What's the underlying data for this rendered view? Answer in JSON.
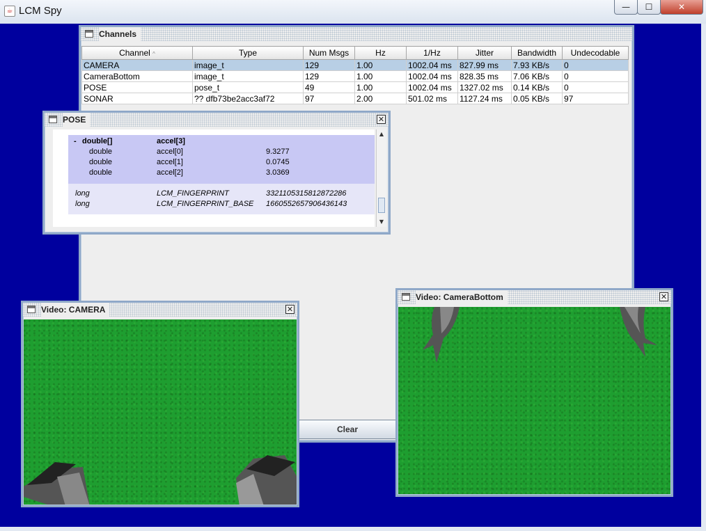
{
  "window": {
    "title": "LCM Spy",
    "controls": {
      "minimize": "—",
      "maximize": "☐",
      "close": "✕"
    }
  },
  "channels_frame": {
    "title": "Channels",
    "columns": [
      "Channel",
      "Type",
      "Num Msgs",
      "Hz",
      "1/Hz",
      "Jitter",
      "Bandwidth",
      "Undecodable"
    ],
    "sort_indicator": "^",
    "rows": [
      [
        "CAMERA",
        "image_t",
        "129",
        "1.00",
        "1002.04 ms",
        "827.99 ms",
        "7.93 KB/s",
        "0"
      ],
      [
        "CameraBottom",
        "image_t",
        "129",
        "1.00",
        "1002.04 ms",
        "828.35 ms",
        "7.06 KB/s",
        "0"
      ],
      [
        "POSE",
        "pose_t",
        "49",
        "1.00",
        "1002.04 ms",
        "1327.02 ms",
        "0.14 KB/s",
        "0"
      ],
      [
        "SONAR",
        "?? dfb73be2acc3af72",
        "97",
        "2.00",
        "501.02 ms",
        "1127.24 ms",
        "0.05 KB/s",
        "97"
      ]
    ],
    "selected_row": 0,
    "clear_button": "Clear"
  },
  "pose_frame": {
    "title": "POSE",
    "array": {
      "toggle": "-",
      "type": "double[]",
      "name": "accel[3]"
    },
    "items": [
      {
        "type": "double",
        "name": "accel[0]",
        "value": "9.3277"
      },
      {
        "type": "double",
        "name": "accel[1]",
        "value": "0.0745"
      },
      {
        "type": "double",
        "name": "accel[2]",
        "value": "3.0369"
      }
    ],
    "fingerprints": [
      {
        "type": "long",
        "name": "LCM_FINGERPRINT",
        "value": "3321105315812872286"
      },
      {
        "type": "long",
        "name": "LCM_FINGERPRINT_BASE",
        "value": "1660552657906436143"
      }
    ],
    "scroll_up": "▲",
    "scroll_down": "▼"
  },
  "video_camera": {
    "title": "Video: CAMERA"
  },
  "video_bottom": {
    "title": "Video: CameraBottom"
  },
  "close_glyph": "✕",
  "colors": {
    "desktop": "#00009e",
    "grass": "#1e9e30",
    "selection": "#b8cfe5",
    "frame_border": "#8fa8c8"
  }
}
